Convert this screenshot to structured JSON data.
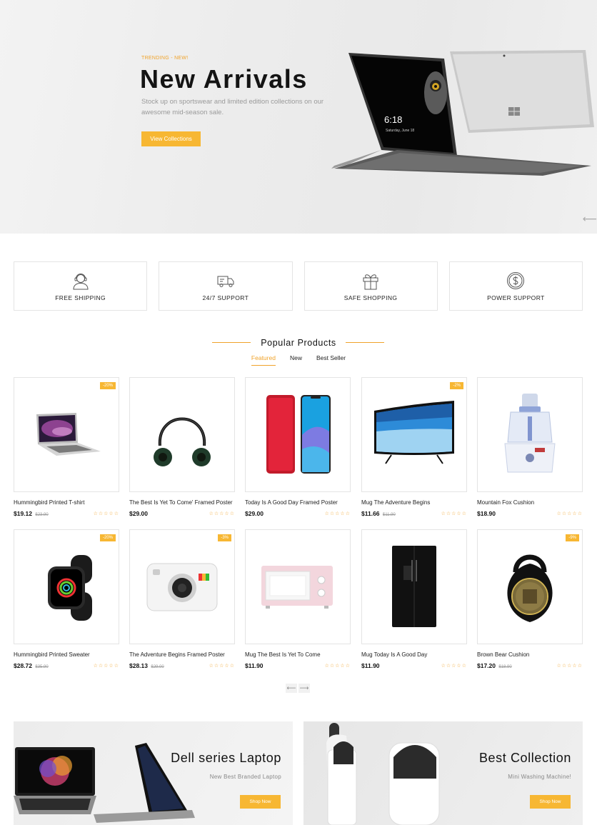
{
  "hero": {
    "tag": "TRENDING - NEW!",
    "title": "New Arrivals",
    "description": "Stock up on sportswear and limited edition collections on our awesome mid-season sale.",
    "cta": "View Collections",
    "tablet_time": "6:18",
    "tablet_date": "Saturday, June 18"
  },
  "features": [
    {
      "label": "FREE SHIPPING",
      "icon": "support-agent-icon"
    },
    {
      "label": "24/7 SUPPORT",
      "icon": "delivery-truck-icon"
    },
    {
      "label": "SAFE SHOPPING",
      "icon": "gift-icon"
    },
    {
      "label": "POWER SUPPORT",
      "icon": "dollar-coin-icon"
    }
  ],
  "section": {
    "title": "Popular Products",
    "tabs": [
      "Featured",
      "New",
      "Best Seller"
    ]
  },
  "products": [
    {
      "name": "Hummingbird Printed T-shirt",
      "price": "$19.12",
      "old_price": "$23.90",
      "badge": "-20%",
      "image": "laptop",
      "stars": "☆☆☆☆☆"
    },
    {
      "name": "The Best Is Yet To Come' Framed Poster",
      "price": "$29.00",
      "old_price": "",
      "badge": "",
      "image": "headphones",
      "stars": "☆☆☆☆☆"
    },
    {
      "name": "Today Is A Good Day Framed Poster",
      "price": "$29.00",
      "old_price": "",
      "badge": "",
      "image": "phone",
      "stars": "☆☆☆☆☆"
    },
    {
      "name": "Mug The Adventure Begins",
      "price": "$11.66",
      "old_price": "$11.90",
      "badge": "-2%",
      "image": "tv",
      "stars": "☆☆☆☆☆"
    },
    {
      "name": "Mountain Fox Cushion",
      "price": "$18.90",
      "old_price": "",
      "badge": "",
      "image": "juicer",
      "stars": "☆☆☆☆☆"
    },
    {
      "name": "Hummingbird Printed Sweater",
      "price": "$28.72",
      "old_price": "$35.90",
      "badge": "-20%",
      "image": "watch",
      "stars": "☆☆☆☆☆"
    },
    {
      "name": "The Adventure Begins Framed Poster",
      "price": "$28.13",
      "old_price": "$29.00",
      "badge": "-3%",
      "image": "camera",
      "stars": "☆☆☆☆☆"
    },
    {
      "name": "Mug The Best Is Yet To Come",
      "price": "$11.90",
      "old_price": "",
      "badge": "",
      "image": "microwave",
      "stars": "☆☆☆☆☆"
    },
    {
      "name": "Mug Today Is A Good Day",
      "price": "$11.90",
      "old_price": "",
      "badge": "",
      "image": "fridge",
      "stars": "☆☆☆☆☆"
    },
    {
      "name": "Brown Bear Cushion",
      "price": "$17.20",
      "old_price": "$18.90",
      "badge": "-9%",
      "image": "speaker",
      "stars": "☆☆☆☆☆"
    }
  ],
  "pager": {
    "prev": "⟵",
    "next": "⟶"
  },
  "banners": [
    {
      "title": "Dell series Laptop",
      "subtitle": "New Best Branded Laptop",
      "button": "Shop Now"
    },
    {
      "title": "Best Collection",
      "subtitle": "Mini Washing Machine!",
      "button": "Shop Now"
    }
  ],
  "colors": {
    "accent": "#f7b733",
    "text": "#111111",
    "border": "#e4e4e4"
  }
}
